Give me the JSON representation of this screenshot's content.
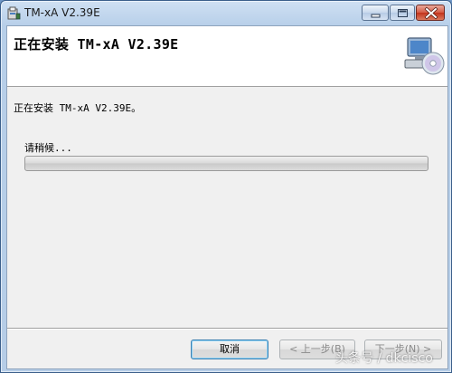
{
  "window": {
    "title": "TM-xA V2.39E",
    "icon": "installer-icon",
    "controls": {
      "minimize_icon": "minimize-icon",
      "maximize_icon": "maximize-icon",
      "close_icon": "close-icon"
    }
  },
  "banner": {
    "title": "正在安装 TM-xA V2.39E",
    "graphic": "computer-cd-icon"
  },
  "body": {
    "status": "正在安装 TM-xA V2.39E。",
    "wait_label": "请稍候...",
    "progress": {
      "value": 0.0
    }
  },
  "buttons": {
    "cancel": "取消",
    "back": "< 上一步(B)",
    "next": "下一步(N) >"
  },
  "watermark": "头条号 / dkcisco",
  "colors": {
    "titlebar": "#b9d1ea",
    "close_button": "#c7402a",
    "default_button_border": "#3c7fb1",
    "disabled_text": "#8a8a8a"
  }
}
